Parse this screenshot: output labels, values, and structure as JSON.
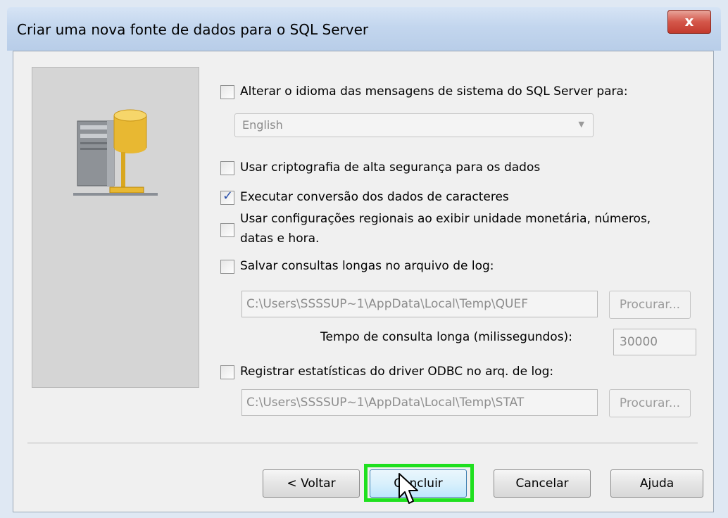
{
  "window": {
    "title": "Criar uma nova fonte de dados para o SQL Server",
    "close_label": "x"
  },
  "options": {
    "change_language": {
      "label": "Alterar o idioma das mensagens de sistema do SQL Server para:",
      "checked": false
    },
    "language_select": {
      "value": "English"
    },
    "strong_encryption": {
      "label": "Usar criptografia de alta segurança para os dados",
      "checked": false
    },
    "char_conversion": {
      "label": "Executar conversão dos dados de caracteres",
      "checked": true
    },
    "regional_settings": {
      "label_line1": "Usar configurações regionais ao exibir unidade monetária, números,",
      "label_line2": "datas e hora.",
      "checked": false
    },
    "long_queries": {
      "label": "Salvar consultas longas no arquivo de log:",
      "checked": false,
      "path": "C:\\Users\\SSSSUP~1\\AppData\\Local\\Temp\\QUEF",
      "browse_label": "Procurar..."
    },
    "long_query_time": {
      "label": "Tempo de consulta longa (milissegundos):",
      "value": "30000"
    },
    "odbc_stats": {
      "label": "Registrar estatísticas do driver ODBC no arq. de log:",
      "checked": false,
      "path": "C:\\Users\\SSSSUP~1\\AppData\\Local\\Temp\\STAT",
      "browse_label": "Procurar..."
    }
  },
  "buttons": {
    "back": "< Voltar",
    "finish": "Concluir",
    "cancel": "Cancelar",
    "help": "Ajuda"
  },
  "icons": {
    "server": "server-database-icon",
    "cursor": "mouse-pointer-icon"
  },
  "colors": {
    "highlight": "#1fe01f",
    "checkmark": "#2a4fa8",
    "close_button": "#c33a2e"
  }
}
